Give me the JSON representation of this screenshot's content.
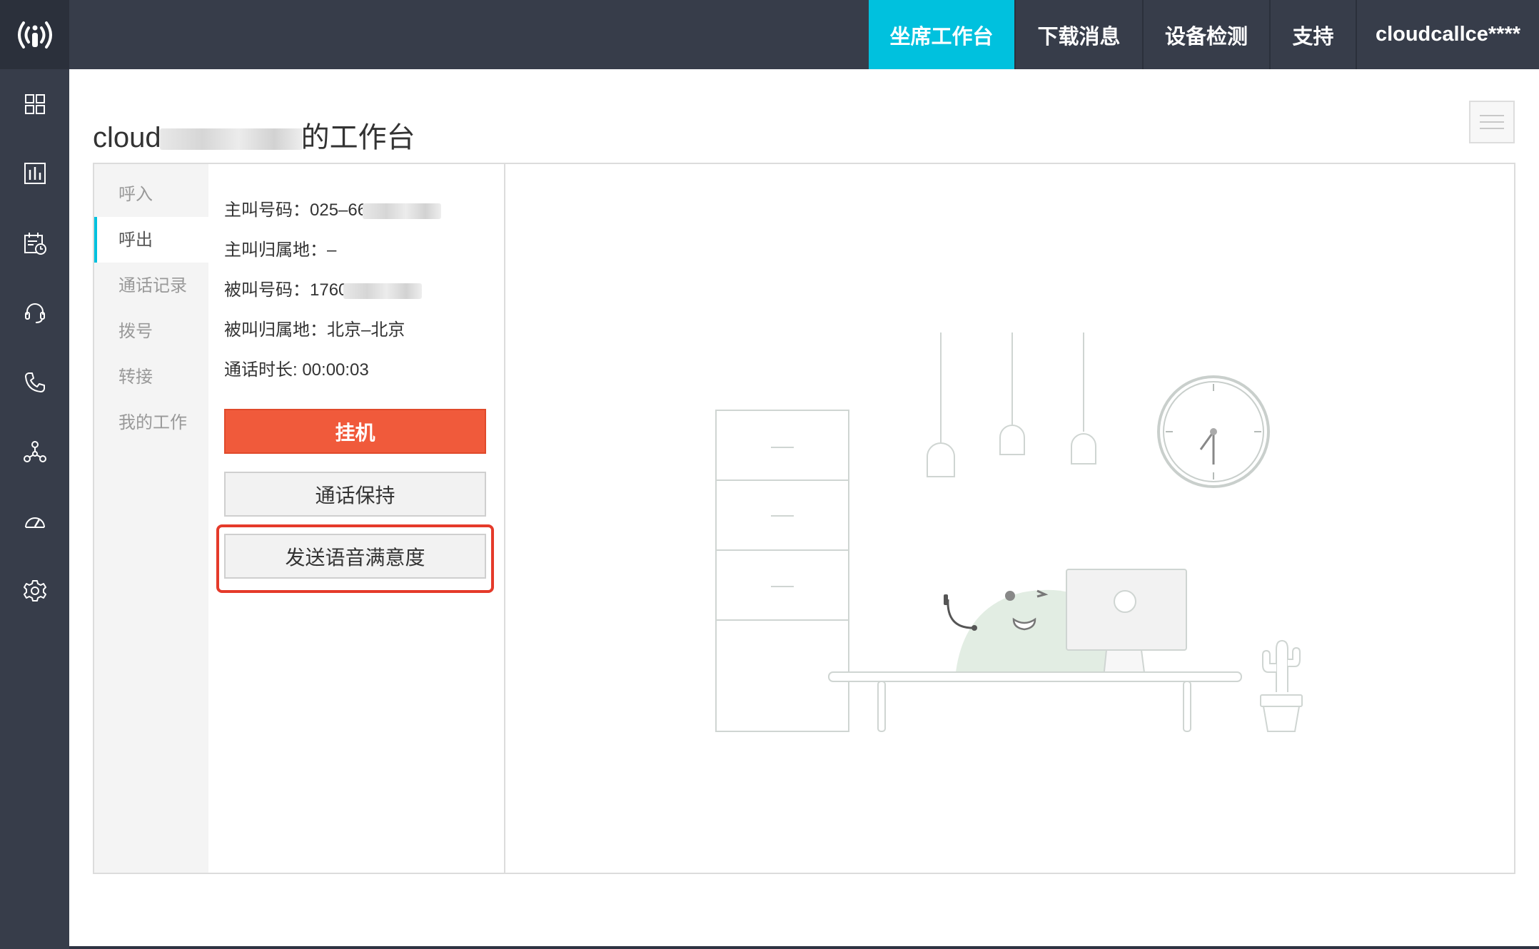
{
  "top_nav": {
    "tabs": [
      {
        "label": "坐席工作台",
        "active": true
      },
      {
        "label": "下载消息"
      },
      {
        "label": "设备检测"
      },
      {
        "label": "支持"
      },
      {
        "label": "cloudcallce****"
      }
    ]
  },
  "sidebar_icons": [
    "grid-icon",
    "bar-chart-icon",
    "calendar-clock-icon",
    "headset-icon",
    "phone-icon",
    "network-icon",
    "speedometer-icon",
    "gear-icon"
  ],
  "page": {
    "title_prefix": "cloud",
    "title_suffix": "的工作台"
  },
  "subnav": {
    "items": [
      {
        "label": "呼入"
      },
      {
        "label": "呼出",
        "active": true
      },
      {
        "label": "通话记录"
      },
      {
        "label": "拨号"
      },
      {
        "label": "转接"
      },
      {
        "label": "我的工作"
      }
    ]
  },
  "call_info": {
    "caller_number": "主叫号码：025–66",
    "caller_location": "主叫归属地：–",
    "callee_number": "被叫号码：1760",
    "callee_location": "被叫归属地：北京–北京",
    "duration": "通话时长: 00:00:03"
  },
  "actions": {
    "hangup": "挂机",
    "hold": "通话保持",
    "send_satisfaction": "发送语音满意度"
  },
  "colors": {
    "accent": "#00c1de",
    "hangup": "#f05a3b",
    "highlight": "#e53a2a",
    "rail": "#373d4a"
  }
}
